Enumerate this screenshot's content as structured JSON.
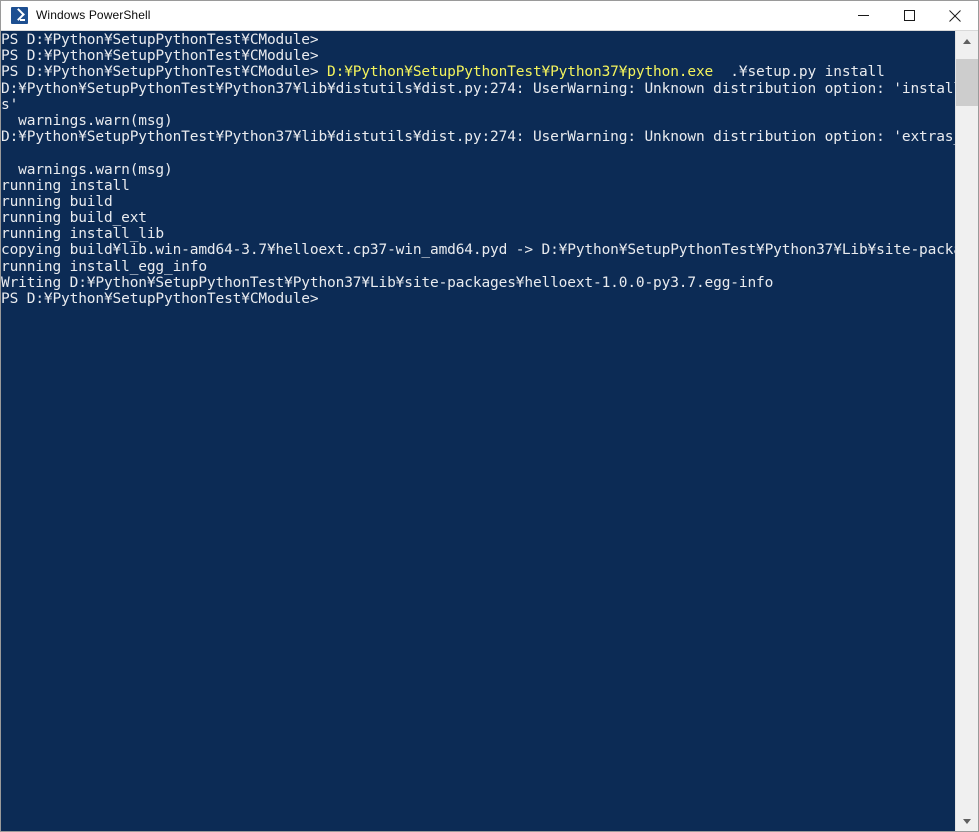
{
  "window": {
    "title": "Windows PowerShell",
    "icon": "powershell-icon",
    "controls": {
      "minimize_label": "Minimize",
      "maximize_label": "Maximize",
      "close_label": "Close"
    },
    "colors": {
      "console_background": "#0c2b55",
      "console_foreground": "#e9ebef",
      "command_accent": "#f3f35c",
      "titlebar_background": "#ffffff",
      "scrollbar_track": "#f0f0f0",
      "scrollbar_thumb": "#cdcdcd"
    }
  },
  "scrollbar": {
    "up_arrow": "chevron-up-icon",
    "down_arrow": "chevron-down-icon",
    "thumb_label": "scroll-thumb"
  },
  "console": {
    "prompt": "PS D:¥Python¥SetupPythonTest¥CModule>",
    "lines": [
      {
        "segments": [
          {
            "text": "PS D:¥Python¥SetupPythonTest¥CModule>",
            "color": "white"
          }
        ]
      },
      {
        "segments": [
          {
            "text": "PS D:¥Python¥SetupPythonTest¥CModule>",
            "color": "white"
          }
        ]
      },
      {
        "segments": [
          {
            "text": "PS D:¥Python¥SetupPythonTest¥CModule> ",
            "color": "white"
          },
          {
            "text": "D:¥Python¥SetupPythonTest¥Python37¥python.exe",
            "color": "yellow"
          },
          {
            "text": "  .¥setup.py install",
            "color": "white"
          }
        ]
      },
      {
        "segments": [
          {
            "text": "D:¥Python¥SetupPythonTest¥Python37¥lib¥distutils¥dist.py:274: UserWarning: Unknown distribution option: 'install_require",
            "color": "white"
          }
        ]
      },
      {
        "segments": [
          {
            "text": "s'",
            "color": "white"
          }
        ]
      },
      {
        "segments": [
          {
            "text": "  warnings.warn(msg)",
            "color": "white"
          }
        ]
      },
      {
        "segments": [
          {
            "text": "D:¥Python¥SetupPythonTest¥Python37¥lib¥distutils¥dist.py:274: UserWarning: Unknown distribution option: 'extras_require'",
            "color": "white"
          }
        ]
      },
      {
        "segments": [
          {
            "text": "",
            "color": "white"
          }
        ]
      },
      {
        "segments": [
          {
            "text": "  warnings.warn(msg)",
            "color": "white"
          }
        ]
      },
      {
        "segments": [
          {
            "text": "running install",
            "color": "white"
          }
        ]
      },
      {
        "segments": [
          {
            "text": "running build",
            "color": "white"
          }
        ]
      },
      {
        "segments": [
          {
            "text": "running build_ext",
            "color": "white"
          }
        ]
      },
      {
        "segments": [
          {
            "text": "running install_lib",
            "color": "white"
          }
        ]
      },
      {
        "segments": [
          {
            "text": "copying build¥lib.win-amd64-3.7¥helloext.cp37-win_amd64.pyd -> D:¥Python¥SetupPythonTest¥Python37¥Lib¥site-packages",
            "color": "white"
          }
        ]
      },
      {
        "segments": [
          {
            "text": "running install_egg_info",
            "color": "white"
          }
        ]
      },
      {
        "segments": [
          {
            "text": "Writing D:¥Python¥SetupPythonTest¥Python37¥Lib¥site-packages¥helloext-1.0.0-py3.7.egg-info",
            "color": "white"
          }
        ]
      },
      {
        "segments": [
          {
            "text": "PS D:¥Python¥SetupPythonTest¥CModule>",
            "color": "white"
          }
        ]
      }
    ]
  }
}
